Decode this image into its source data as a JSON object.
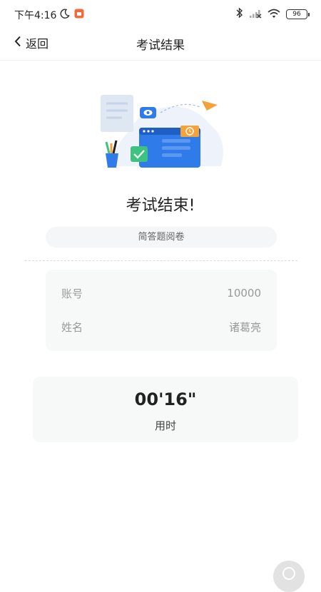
{
  "status_bar": {
    "time": "下午4:16",
    "battery": "96",
    "icons": [
      "moon-icon",
      "app-notification-icon",
      "bluetooth-icon",
      "signal-icon",
      "wifi-icon",
      "battery-icon"
    ]
  },
  "nav": {
    "back_label": "返回",
    "title": "考试结果"
  },
  "result": {
    "heading": "考试结束!",
    "paper_name": "简答题阅卷"
  },
  "info": {
    "rows": [
      {
        "label": "账号",
        "value": "10000"
      },
      {
        "label": "姓名",
        "value": "诸葛亮"
      }
    ]
  },
  "timing": {
    "value": "00'16\"",
    "label": "用时"
  },
  "colors": {
    "accent_blue": "#2f7bea",
    "accent_orange": "#f4a23a",
    "check_green": "#3ec27f",
    "card_bg": "#f7f8f8"
  }
}
